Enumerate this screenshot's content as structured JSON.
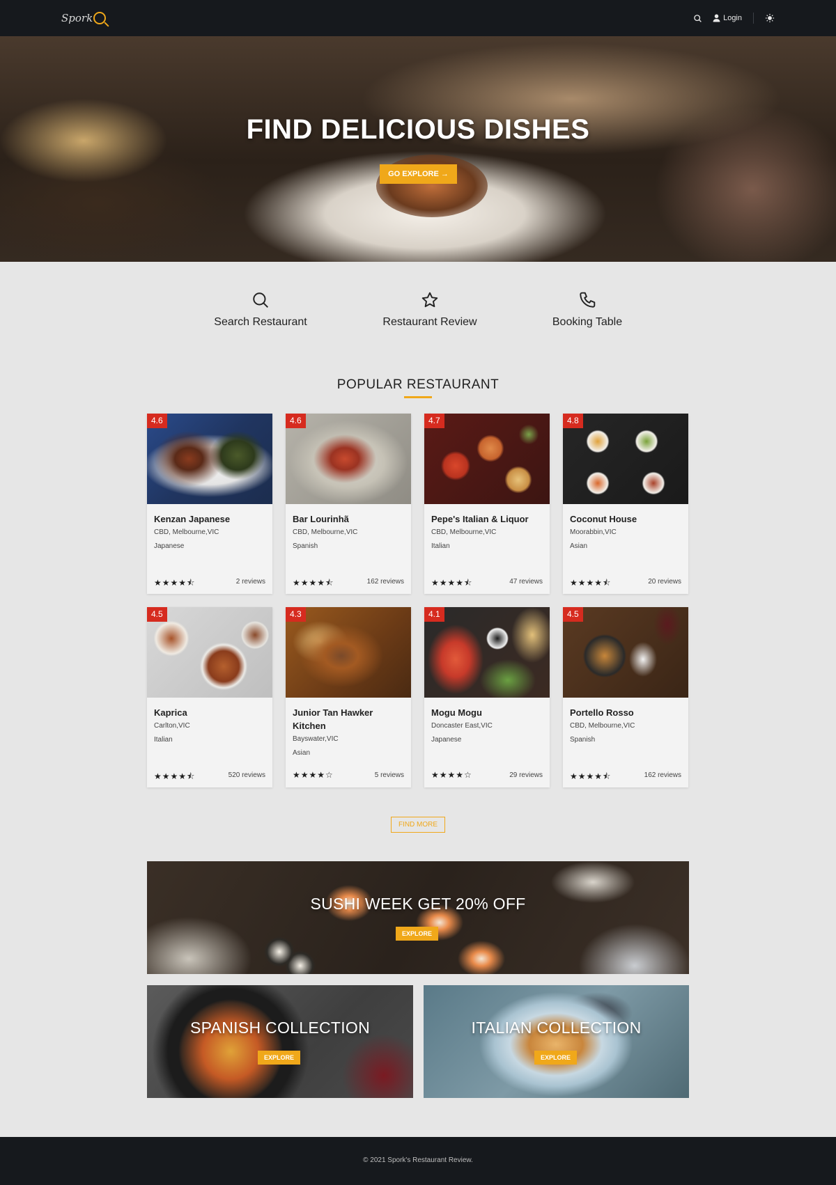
{
  "nav": {
    "logo_text": "Spork",
    "login_label": "Login",
    "icons": [
      "search-icon",
      "user-icon",
      "sun-icon"
    ]
  },
  "hero": {
    "title": "FIND DELICIOUS DISHES",
    "button_label": "GO EXPLORE →"
  },
  "features": [
    {
      "label": "Search Restaurant",
      "icon": "search-icon"
    },
    {
      "label": "Restaurant Review",
      "icon": "star-icon"
    },
    {
      "label": "Booking Table",
      "icon": "phone-icon"
    }
  ],
  "popular": {
    "title": "POPULAR RESTAURANT",
    "restaurants": [
      {
        "rating": "4.6",
        "name": "Kenzan Japanese",
        "location": "CBD, Melbourne,VIC",
        "cuisine": "Japanese",
        "stars": "★★★★⯪",
        "reviews": "2 reviews"
      },
      {
        "rating": "4.6",
        "name": "Bar Lourinhã",
        "location": "CBD, Melbourne,VIC",
        "cuisine": "Spanish",
        "stars": "★★★★⯪",
        "reviews": "162 reviews"
      },
      {
        "rating": "4.7",
        "name": "Pepe's Italian & Liquor",
        "location": "CBD, Melbourne,VIC",
        "cuisine": "Italian",
        "stars": "★★★★⯪",
        "reviews": "47 reviews"
      },
      {
        "rating": "4.8",
        "name": "Coconut House",
        "location": "Moorabbin,VIC",
        "cuisine": "Asian",
        "stars": "★★★★⯪",
        "reviews": "20 reviews"
      },
      {
        "rating": "4.5",
        "name": "Kaprica",
        "location": "Carlton,VIC",
        "cuisine": "Italian",
        "stars": "★★★★⯪",
        "reviews": "520 reviews"
      },
      {
        "rating": "4.3",
        "name": "Junior Tan Hawker Kitchen",
        "location": "Bayswater,VIC",
        "cuisine": "Asian",
        "stars": "★★★★☆",
        "reviews": "5 reviews"
      },
      {
        "rating": "4.1",
        "name": "Mogu Mogu",
        "location": "Doncaster East,VIC",
        "cuisine": "Japanese",
        "stars": "★★★★☆",
        "reviews": "29 reviews"
      },
      {
        "rating": "4.5",
        "name": "Portello Rosso",
        "location": "CBD, Melbourne,VIC",
        "cuisine": "Spanish",
        "stars": "★★★★⯪",
        "reviews": "162 reviews"
      }
    ],
    "find_more_label": "FIND MORE"
  },
  "promos": {
    "sushi": {
      "title": "SUSHI WEEK GET 20% OFF",
      "button_label": "EXPLORE"
    },
    "spanish": {
      "title": "SPANISH COLLECTION",
      "button_label": "EXPLORE"
    },
    "italian": {
      "title": "ITALIAN COLLECTION",
      "button_label": "EXPLORE"
    }
  },
  "footer": {
    "copyright": "© 2021 Spork's Restaurant Review."
  },
  "colors": {
    "accent": "#f0a81a",
    "badge": "#d62b1f",
    "dark": "#16191d",
    "page_bg": "#e6e6e6"
  }
}
